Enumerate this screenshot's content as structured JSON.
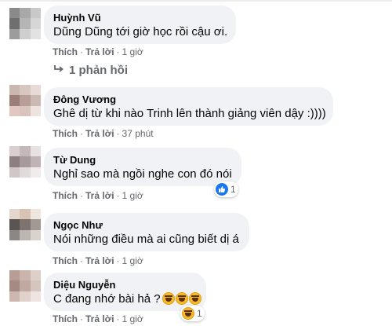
{
  "comments": [
    {
      "author": "Huỳnh Vũ",
      "text": "Dũng Dũng tới giờ học rồi cậu ơi.",
      "actions": {
        "like": "Thích",
        "reply": "Trả lời",
        "time": "1 giờ"
      },
      "replies_link": "1 phản hồi",
      "avatar_colors": [
        "#8a8a8a",
        "#a8a8a8",
        "#c9c9c9",
        "#6f6f6f",
        "#b5b5b5",
        "#d6d6d6",
        "#9c9c9c",
        "#cfcfcf",
        "#e2e2e2"
      ]
    },
    {
      "author": "Đông Vương",
      "text": "Ghê dị từ khi nào Trinh lên thành giảng viên dậy :))))",
      "actions": {
        "like": "Thích",
        "reply": "Trả lời",
        "time": "37 phút"
      },
      "avatar_colors": [
        "#c9b7b2",
        "#d8c7c1",
        "#e6dbd6",
        "#9c7e78",
        "#b79e97",
        "#cdb9b3",
        "#e0c8c0",
        "#d9c4bd",
        "#efe3df"
      ]
    },
    {
      "author": "Từ Dung",
      "text": "Nghỉ sao mà ngồi nghe con đó nói",
      "actions": {
        "like": "Thích",
        "reply": "Trả lời",
        "time": "1 giờ"
      },
      "reactions": {
        "type": "like-icon",
        "count": "1"
      },
      "avatar_colors": [
        "#d9cfd0",
        "#c4b8ba",
        "#e8e1e2",
        "#8d7e80",
        "#a79a9c",
        "#bfb3b5",
        "#d0c6c7",
        "#e1dadb",
        "#f0ebec"
      ]
    },
    {
      "author": "Ngọc Như",
      "text": "Nói những điều mà ai cũng biết dị á",
      "actions": {
        "like": "Thích",
        "reply": "Trả lời",
        "time": "1 giờ"
      },
      "avatar_colors": [
        "#e4d6cc",
        "#d8c2b3",
        "#efe6df",
        "#5a5552",
        "#7d7470",
        "#a39993",
        "#8a8785",
        "#bdb5b0",
        "#d9d2cd"
      ]
    },
    {
      "author": "Diệu Nguyễn",
      "text": "C đang nhớ bài hả ?",
      "actions": {
        "like": "Thích",
        "reply": "Trả lời",
        "time": "1 giờ"
      },
      "text_emoji_names": [
        "haha-icon",
        "haha-icon",
        "haha-icon"
      ],
      "reactions": {
        "type": "haha-icon",
        "count": "1"
      },
      "avatar_colors": [
        "#b89d96",
        "#cbb4ad",
        "#ddcfca",
        "#a58a84",
        "#c1a9a2",
        "#d6c4be",
        "#cdb7b0",
        "#e0d1cb",
        "#eee5e1"
      ]
    }
  ]
}
